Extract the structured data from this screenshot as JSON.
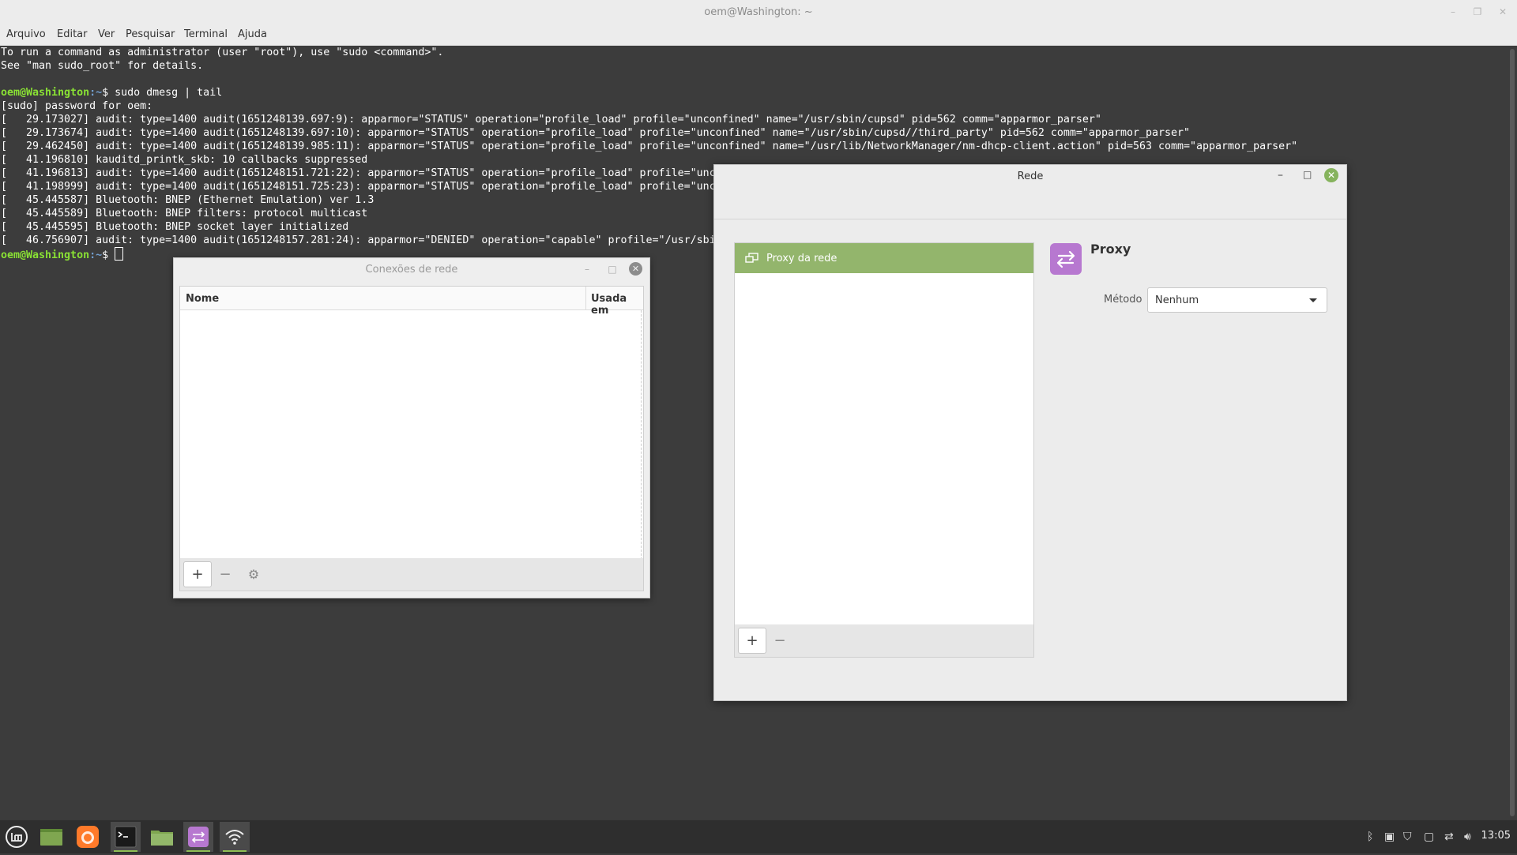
{
  "terminal": {
    "window_title": "oem@Washington: ~",
    "menu": [
      "Arquivo",
      "Editar",
      "Ver",
      "Pesquisar",
      "Terminal",
      "Ajuda"
    ],
    "lines": [
      "To run a command as administrator (user \"root\"), use \"sudo <command>\".",
      "See \"man sudo_root\" for details.",
      "",
      "",
      "[sudo] password for oem:",
      "[   29.173027] audit: type=1400 audit(1651248139.697:9): apparmor=\"STATUS\" operation=\"profile_load\" profile=\"unconfined\" name=\"/usr/sbin/cupsd\" pid=562 comm=\"apparmor_parser\"",
      "[   29.173674] audit: type=1400 audit(1651248139.697:10): apparmor=\"STATUS\" operation=\"profile_load\" profile=\"unconfined\" name=\"/usr/sbin/cupsd//third_party\" pid=562 comm=\"apparmor_parser\"",
      "[   29.462450] audit: type=1400 audit(1651248139.985:11): apparmor=\"STATUS\" operation=\"profile_load\" profile=\"unconfined\" name=\"/usr/lib/NetworkManager/nm-dhcp-client.action\" pid=563 comm=\"apparmor_parser\"",
      "[   41.196810] kauditd_printk_skb: 10 callbacks suppressed",
      "[   41.196813] audit: type=1400 audit(1651248151.721:22): apparmor=\"STATUS\" operation=\"profile_load\" profile=\"unc",
      "[   41.198999] audit: type=1400 audit(1651248151.725:23): apparmor=\"STATUS\" operation=\"profile_load\" profile=\"unc",
      "[   45.445587] Bluetooth: BNEP (Ethernet Emulation) ver 1.3",
      "[   45.445589] Bluetooth: BNEP filters: protocol multicast",
      "[   45.445595] Bluetooth: BNEP socket layer initialized",
      "[   46.756907] audit: type=1400 audit(1651248157.281:24): apparmor=\"DENIED\" operation=\"capable\" profile=\"/usr/sbi"
    ],
    "prompt_user_host": "oem@Washington",
    "prompt_path": ":~",
    "prompt_symbol": "$ ",
    "command": "sudo dmesg | tail"
  },
  "network_connections": {
    "window_title": "Conexões de rede",
    "columns": [
      "Nome",
      "Usada em"
    ],
    "rows": [],
    "toolbar": {
      "add": "+",
      "remove": "−",
      "settings": "⚙"
    }
  },
  "rede": {
    "window_title": "Rede",
    "list_items": [
      {
        "label": "Proxy da rede",
        "icon": "network-proxy-icon",
        "selected": true
      }
    ],
    "toolbar": {
      "add": "+",
      "remove": "−"
    },
    "detail_title": "Proxy",
    "method_label": "Método",
    "method_value": "Nenhum"
  },
  "taskbar": {
    "apps": [
      "mint-menu-icon",
      "show-desktop-icon",
      "firefox-icon",
      "terminal-icon",
      "files-icon",
      "network-proxy-icon",
      "network-icon"
    ],
    "tray": [
      "bluetooth-icon",
      "clipboard-icon",
      "shield-icon",
      "removable-drive-icon",
      "network-status-icon",
      "volume-icon"
    ],
    "clock": "13:05"
  },
  "colors": {
    "accent": "#93b56c",
    "terminal_bg": "#3c3c3c",
    "prompt_green": "#8ae234",
    "prompt_blue": "#729fcf",
    "proxy_purple": "#b778d0"
  }
}
